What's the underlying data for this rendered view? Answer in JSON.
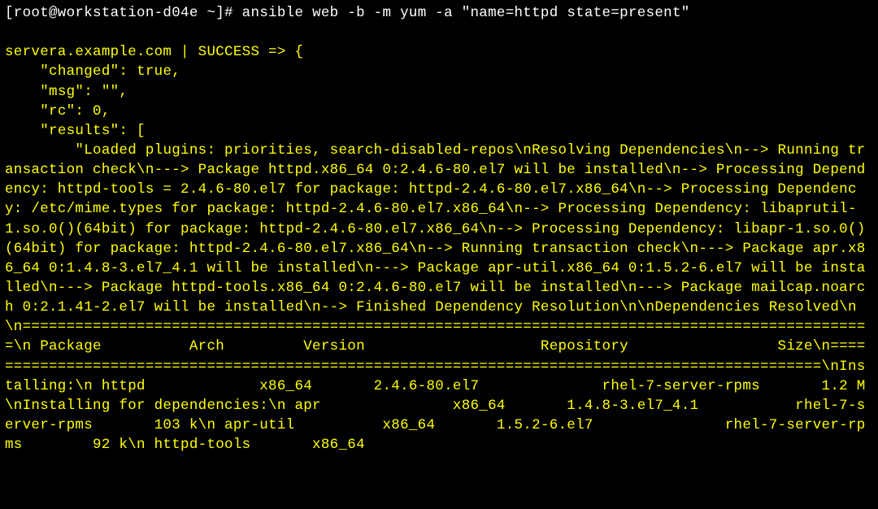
{
  "prompt": "[root@workstation-d04e ~]# ",
  "command": "ansible web -b -m yum -a \"name=httpd state=present\"",
  "lines": [
    "servera.example.com | SUCCESS => {",
    "    \"changed\": true,",
    "    \"msg\": \"\",",
    "    \"rc\": 0,",
    "    \"results\": [",
    "        \"Loaded plugins: priorities, search-disabled-repos\\nResolving Dependencies\\n--> Running transaction check\\n---> Package httpd.x86_64 0:2.4.6-80.el7 will be installed\\n--> Processing Dependency: httpd-tools = 2.4.6-80.el7 for package: httpd-2.4.6-80.el7.x86_64\\n--> Processing Dependency: /etc/mime.types for package: httpd-2.4.6-80.el7.x86_64\\n--> Processing Dependency: libaprutil-1.so.0()(64bit) for package: httpd-2.4.6-80.el7.x86_64\\n--> Processing Dependency: libapr-1.so.0()(64bit) for package: httpd-2.4.6-80.el7.x86_64\\n--> Running transaction check\\n---> Package apr.x86_64 0:1.4.8-3.el7_4.1 will be installed\\n---> Package apr-util.x86_64 0:1.5.2-6.el7 will be installed\\n---> Package httpd-tools.x86_64 0:2.4.6-80.el7 will be installed\\n---> Package mailcap.noarch 0:2.1.41-2.el7 will be installed\\n--> Finished Dependency Resolution\\n\\nDependencies Resolved\\n\\n=================================================================================================\\n Package          Arch         Version                    Repository                 Size\\n=================================================================================================\\nInstalling:\\n httpd             x86_64       2.4.6-80.el7              rhel-7-server-rpms       1.2 M\\nInstalling for dependencies:\\n apr               x86_64       1.4.8-3.el7_4.1           rhel-7-server-rpms       103 k\\n apr-util          x86_64       1.5.2-6.el7               rhel-7-server-rpms        92 k\\n httpd-tools       x86_64"
  ]
}
